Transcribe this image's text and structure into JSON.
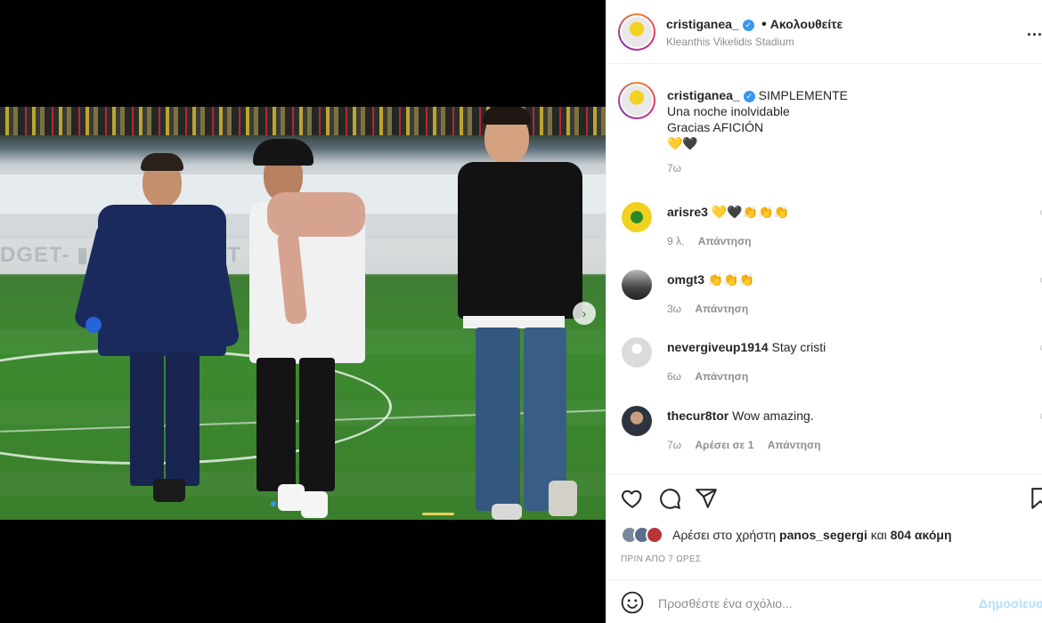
{
  "post": {
    "username": "cristiganea_",
    "follow_state": "Ακολουθείτε",
    "location": "Kleanthis Vikelidis Stadium",
    "more_label": "..."
  },
  "photo": {
    "ad_text": "DGET-   ▮ NG   ▮ V  DGET  ▮  V  ▮  GET",
    "carousel_next": "›"
  },
  "caption": {
    "username": "cristiganea_",
    "line1": "SIMPLEMENTE",
    "line2": "Una noche inolvidable",
    "line3": "Gracias AFICIÓN",
    "emoji": "💛🖤",
    "time": "7ω"
  },
  "comments": [
    {
      "username": "arisre3",
      "text": "💛🖤👏👏👏",
      "time": "9 λ.",
      "likes": "",
      "reply": "Απάντηση"
    },
    {
      "username": "omgt3",
      "text": "👏👏👏",
      "time": "3ω",
      "likes": "",
      "reply": "Απάντηση"
    },
    {
      "username": "nevergiveup1914",
      "text": "Stay cristi",
      "time": "6ω",
      "likes": "",
      "reply": "Απάντηση"
    },
    {
      "username": "thecur8tor",
      "text": "Wow amazing.",
      "time": "7ω",
      "likes": "Αρέσει σε 1",
      "reply": "Απάντηση"
    }
  ],
  "likes": {
    "prefix": "Αρέσει στο χρήστη",
    "user": "panos_segergi",
    "middle": "και",
    "count": "804 ακόμη"
  },
  "time_ago": "ΠΡΙΝ ΑΠΟ 7 ΩΡΕΣ",
  "add_comment": {
    "placeholder": "Προσθέστε ένα σχόλιο...",
    "publish": "Δημοσίευση"
  },
  "colors": {
    "link_blue": "#3897f0",
    "publish_disabled": "#b2dffc",
    "secondary_text": "#8e8e8e"
  }
}
